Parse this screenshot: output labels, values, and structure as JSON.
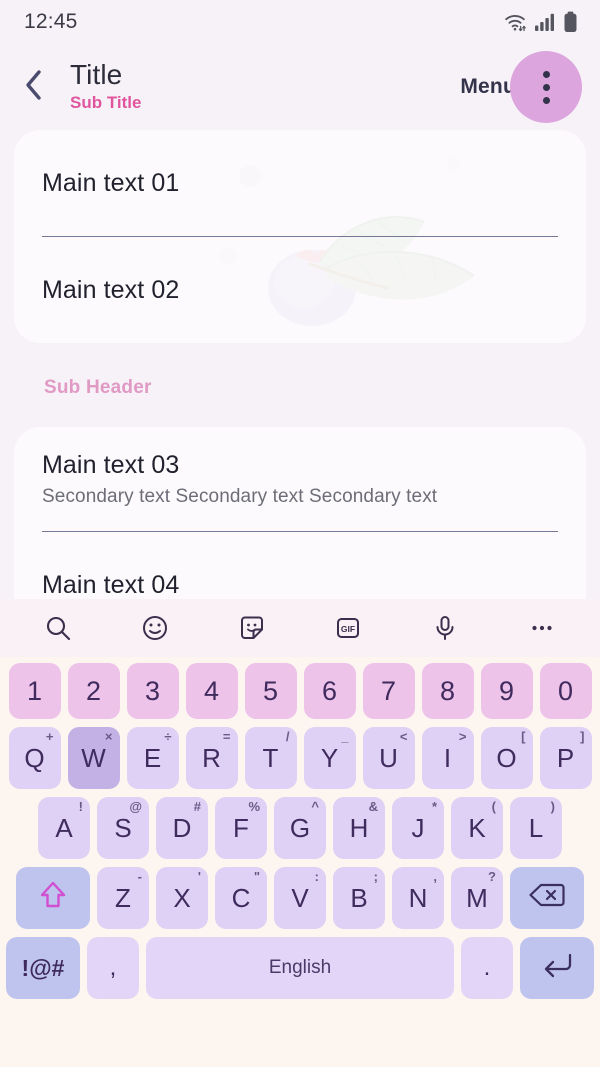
{
  "statusbar": {
    "time": "12:45",
    "icons": [
      "wifi-icon",
      "signal-icon",
      "battery-icon"
    ]
  },
  "appbar": {
    "back_icon": "chevron-left-icon",
    "title": "Title",
    "subtitle": "Sub Title",
    "menu_label": "Menu",
    "overflow_icon": "overflow-menu-icon"
  },
  "content": {
    "card1": [
      {
        "main": "Main text 01"
      },
      {
        "main": "Main text 02"
      }
    ],
    "subheader": "Sub Header",
    "card2": [
      {
        "main": "Main text 03",
        "secondary": "Secondary text Secondary text Secondary text"
      },
      {
        "main": "Main text 04"
      }
    ]
  },
  "keyboard": {
    "toolbar": [
      {
        "name": "search-icon"
      },
      {
        "name": "emoji-icon"
      },
      {
        "name": "sticker-icon"
      },
      {
        "name": "gif-icon",
        "label": "GIF"
      },
      {
        "name": "microphone-icon"
      },
      {
        "name": "more-options-icon"
      }
    ],
    "number_row": [
      "1",
      "2",
      "3",
      "4",
      "5",
      "6",
      "7",
      "8",
      "9",
      "0"
    ],
    "row1": [
      {
        "key": "Q",
        "sup": "+"
      },
      {
        "key": "W",
        "sup": "×",
        "pressed": true
      },
      {
        "key": "E",
        "sup": "÷"
      },
      {
        "key": "R",
        "sup": "="
      },
      {
        "key": "T",
        "sup": "/"
      },
      {
        "key": "Y",
        "sup": "_"
      },
      {
        "key": "U",
        "sup": "<"
      },
      {
        "key": "I",
        "sup": ">"
      },
      {
        "key": "O",
        "sup": "["
      },
      {
        "key": "P",
        "sup": "]"
      }
    ],
    "row2": [
      {
        "key": "A",
        "sup": "!"
      },
      {
        "key": "S",
        "sup": "@"
      },
      {
        "key": "D",
        "sup": "#"
      },
      {
        "key": "F",
        "sup": "%"
      },
      {
        "key": "G",
        "sup": "^"
      },
      {
        "key": "H",
        "sup": "&"
      },
      {
        "key": "J",
        "sup": "*"
      },
      {
        "key": "K",
        "sup": "("
      },
      {
        "key": "L",
        "sup": ")"
      }
    ],
    "row3": [
      {
        "key": "Z",
        "sup": "-"
      },
      {
        "key": "X",
        "sup": "'"
      },
      {
        "key": "C",
        "sup": "\""
      },
      {
        "key": "V",
        "sup": ":"
      },
      {
        "key": "B",
        "sup": ";"
      },
      {
        "key": "N",
        "sup": ","
      },
      {
        "key": "M",
        "sup": "?"
      }
    ],
    "shift_icon": "shift-arrow-icon",
    "backspace_icon": "backspace-icon",
    "symbols_label": "!@#",
    "comma_label": ",",
    "space_label": "English",
    "period_label": ".",
    "enter_icon": "enter-icon"
  },
  "colors": {
    "page_bg": "#f7f2f8",
    "accent_pink": "#e0569e",
    "subheader_pink": "#e09ac4",
    "overflow_circle": "#dca5dd",
    "key_number": "#eec3ea",
    "key_letter": "#dfd0f5",
    "key_pressed": "#c3b1e6",
    "key_function": "#bfc4ee",
    "keyboard_bg": "#fdf6f0",
    "shift_arrow": "#d14fd1"
  }
}
